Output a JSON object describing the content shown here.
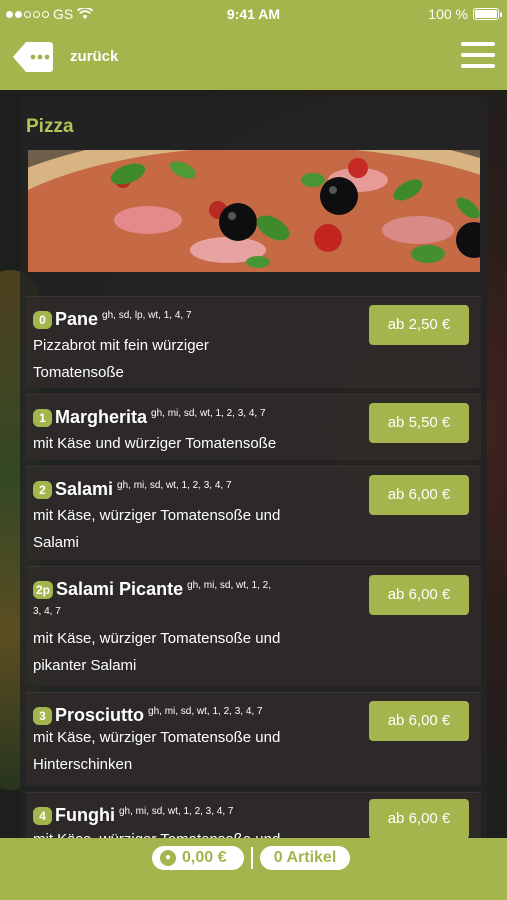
{
  "status": {
    "carrier": "GS",
    "time": "9:41 AM",
    "battery": "100 %",
    "battery_level": 1.0,
    "signal_bars": 5,
    "signal_filled": 2
  },
  "nav": {
    "back_label": "zurück",
    "back_icon": "back-tag-icon",
    "menu_icon": "hamburger-icon"
  },
  "section": {
    "title": "Pizza",
    "hero_image": "pizza-photo"
  },
  "items": [
    {
      "number": "0",
      "name": "Pane",
      "allergens": "gh, sd, lp, wt, 1, 4, 7",
      "desc_lines": [
        "Pizzabrot mit fein würziger",
        "Tomatensoße"
      ],
      "price": "ab 2,50 €"
    },
    {
      "number": "1",
      "name": "Margherita",
      "allergens": "gh, mi, sd, wt, 1, 2, 3, 4, 7",
      "desc_lines": [
        "mit Käse und würziger Tomatensoße"
      ],
      "price": "ab 5,50 €"
    },
    {
      "number": "2",
      "name": "Salami",
      "allergens": "gh, mi, sd, wt, 1, 2, 3, 4, 7",
      "desc_lines": [
        "mit Käse, würziger Tomatensoße und",
        "Salami"
      ],
      "price": "ab 6,00 €"
    },
    {
      "number": "2p",
      "name": "Salami Picante",
      "allergens": "gh, mi, sd, wt, 1, 2,",
      "allergens_cont": "3, 4, 7",
      "desc_lines": [
        "mit Käse, würziger Tomatensoße und",
        "pikanter Salami"
      ],
      "price": "ab 6,00 €"
    },
    {
      "number": "3",
      "name": "Prosciutto",
      "allergens": "gh, mi, sd, wt, 1, 2, 3, 4, 7",
      "desc_lines": [
        "mit Käse, würziger Tomatensoße und",
        "Hinterschinken"
      ],
      "price": "ab 6,00 €"
    },
    {
      "number": "4",
      "name": "Funghi",
      "allergens": "gh, mi, sd, wt, 1, 2, 3, 4, 7",
      "desc_lines": [
        "mit Käse, würziger Tomatensoße und"
      ],
      "price": "ab 6,00 €"
    }
  ],
  "cart": {
    "total": "0,00 €",
    "count": "0 Artikel",
    "cart_icon": "shopping-cart-icon"
  }
}
